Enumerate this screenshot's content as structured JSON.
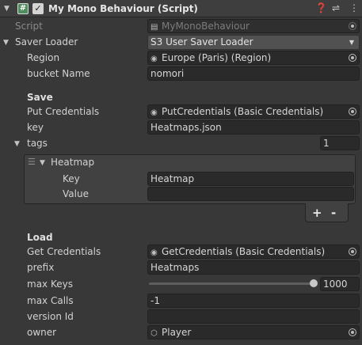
{
  "header": {
    "title": "My Mono Behaviour (Script)",
    "enabled": true,
    "icons": [
      "foldout-arrow-icon",
      "script-icon",
      "help-icon",
      "presets-icon",
      "kebab-menu-icon"
    ]
  },
  "script": {
    "label": "Script",
    "value": "MyMonoBehaviour"
  },
  "saver_loader": {
    "label": "Saver Loader",
    "value": "S3 User Saver Loader"
  },
  "region": {
    "label": "Region",
    "value": "Europe (Paris) (Region)"
  },
  "bucket_name": {
    "label": "bucket Name",
    "value": "nomori"
  },
  "save": {
    "heading": "Save",
    "put_credentials": {
      "label": "Put Credentials",
      "value": "PutCredentials (Basic Credentials)"
    },
    "key": {
      "label": "key",
      "value": "Heatmaps.json"
    },
    "tags": {
      "label": "tags",
      "count": "1",
      "items": [
        {
          "label": "Heatmap",
          "key_label": "Key",
          "key_value": "Heatmap",
          "value_label": "Value",
          "value_value": ""
        }
      ],
      "add_label": "+",
      "remove_label": "-"
    }
  },
  "load": {
    "heading": "Load",
    "get_credentials": {
      "label": "Get Credentials",
      "value": "GetCredentials (Basic Credentials)"
    },
    "prefix": {
      "label": "prefix",
      "value": "Heatmaps"
    },
    "max_keys": {
      "label": "max Keys",
      "value": "1000",
      "slider_fraction": 1.0
    },
    "max_calls": {
      "label": "max Calls",
      "value": "-1"
    },
    "version_id": {
      "label": "version Id",
      "value": ""
    },
    "owner": {
      "label": "owner",
      "value": "Player"
    }
  }
}
